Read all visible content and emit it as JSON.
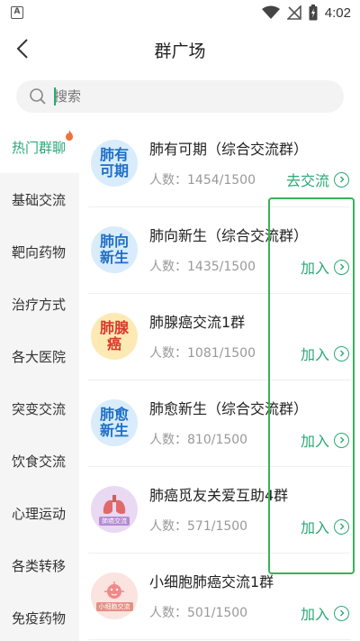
{
  "status_bar": {
    "time": "4:02",
    "badge": "A"
  },
  "header": {
    "title": "群广场"
  },
  "search": {
    "placeholder": "搜索"
  },
  "sidebar": {
    "items": [
      {
        "label": "热门群聊",
        "active": true
      },
      {
        "label": "基础交流"
      },
      {
        "label": "靶向药物"
      },
      {
        "label": "治疗方式"
      },
      {
        "label": "各大医院"
      },
      {
        "label": "突变交流"
      },
      {
        "label": "饮食交流"
      },
      {
        "label": "心理运动"
      },
      {
        "label": "各类转移"
      },
      {
        "label": "免疫药物"
      }
    ]
  },
  "groups": [
    {
      "name": "肺有可期（综合交流群）",
      "count_label": "人数：",
      "count": "1454/1500",
      "action": "去交流",
      "avatar_text": "肺有\n可期",
      "avatar_bg": "#d9ecfb",
      "avatar_color": "#1f6fc7"
    },
    {
      "name": "肺向新生（综合交流群）",
      "count_label": "人数：",
      "count": "1435/1500",
      "action": "加入",
      "avatar_text": "肺向\n新生",
      "avatar_bg": "#d9ecfb",
      "avatar_color": "#1f6fc7"
    },
    {
      "name": "肺腺癌交流1群",
      "count_label": "人数：",
      "count": "1081/1500",
      "action": "加入",
      "avatar_text": "肺腺\n癌",
      "avatar_bg": "#fde9b4",
      "avatar_color": "#d9372b"
    },
    {
      "name": "肺愈新生（综合交流群）",
      "count_label": "人数：",
      "count": "810/1500",
      "action": "加入",
      "avatar_text": "肺愈\n新生",
      "avatar_bg": "#d9ecfb",
      "avatar_color": "#1f6fc7"
    },
    {
      "name": "肺癌觅友关爱互助4群",
      "count_label": "人数：",
      "count": "571/1500",
      "action": "加入",
      "avatar_text": "",
      "avatar_caption": "肺癌交流",
      "avatar_bg": "#e9d9f3",
      "avatar_color": "#ffffff"
    },
    {
      "name": "小细胞肺癌交流1群",
      "count_label": "人数：",
      "count": "501/1500",
      "action": "加入",
      "avatar_text": "",
      "avatar_caption": "小细胞交流",
      "avatar_bg": "#fbe3df",
      "avatar_color": "#ffffff"
    }
  ],
  "colors": {
    "accent": "#2aa876",
    "highlight": "#36b358"
  },
  "icons": {
    "back": "back-arrow-icon",
    "search": "search-icon",
    "fire": "fire-icon",
    "chevron": "chevron-right-icon"
  }
}
